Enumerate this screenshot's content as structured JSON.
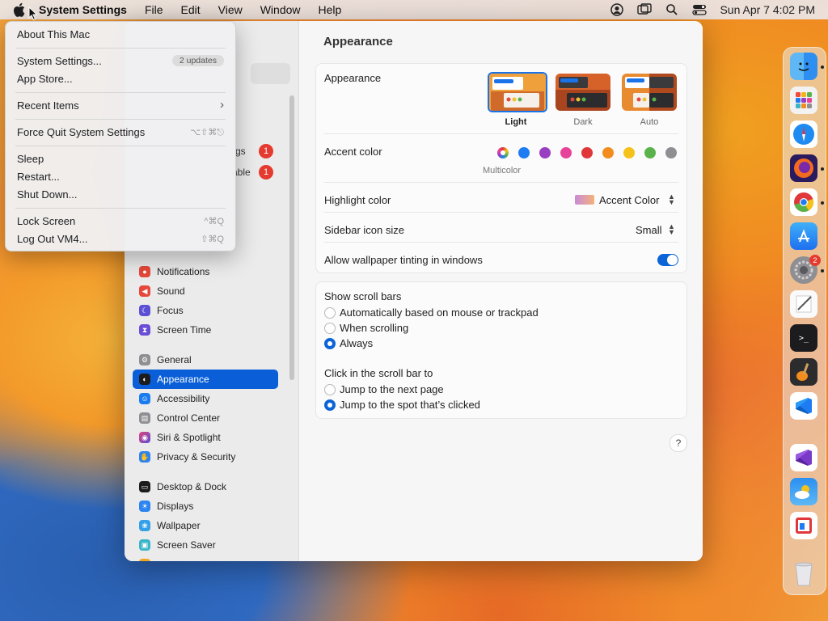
{
  "menubar": {
    "app_name": "System Settings",
    "menus": [
      "File",
      "Edit",
      "View",
      "Window",
      "Help"
    ],
    "clock": "Sun Apr 7  4:02 PM"
  },
  "apple_menu": {
    "about": "About This Mac",
    "system_settings": "System Settings...",
    "updates_badge": "2 updates",
    "app_store": "App Store...",
    "recent_items": "Recent Items",
    "force_quit": "Force Quit System Settings",
    "force_quit_shortcut": "⌥⇧⌘⎋",
    "sleep": "Sleep",
    "restart": "Restart...",
    "shut_down": "Shut Down...",
    "lock_screen": "Lock Screen",
    "lock_screen_shortcut": "^⌘Q",
    "log_out": "Log Out VM4...",
    "log_out_shortcut": "⇧⌘Q"
  },
  "sidebar": {
    "partial_1": "gs",
    "partial_2": "able",
    "badge_1": "1",
    "badge_2": "1",
    "items": [
      {
        "label": "Notifications",
        "color": "#e5483a"
      },
      {
        "label": "Sound",
        "color": "#e5483a"
      },
      {
        "label": "Focus",
        "color": "#5b4fd6"
      },
      {
        "label": "Screen Time",
        "color": "#6a4ed6"
      },
      {
        "label": "General",
        "color": "#8e8e93"
      },
      {
        "label": "Appearance",
        "color": "#1c1c1e"
      },
      {
        "label": "Accessibility",
        "color": "#1b7cf0"
      },
      {
        "label": "Control Center",
        "color": "#8e8e93"
      },
      {
        "label": "Siri & Spotlight",
        "color": "#b23ad6"
      },
      {
        "label": "Privacy & Security",
        "color": "#2b84f0"
      },
      {
        "label": "Desktop & Dock",
        "color": "#1c1c1e"
      },
      {
        "label": "Displays",
        "color": "#2b84f0"
      },
      {
        "label": "Wallpaper",
        "color": "#34a0e8"
      },
      {
        "label": "Screen Saver",
        "color": "#3ab5c8"
      }
    ]
  },
  "content": {
    "title": "Appearance",
    "appearance_label": "Appearance",
    "modes": [
      "Light",
      "Dark",
      "Auto"
    ],
    "accent_label": "Accent color",
    "accent_colors": [
      "#1e7cf2",
      "#9b3fc2",
      "#e8439a",
      "#e0383a",
      "#f28c1e",
      "#f5c21c",
      "#5ab34a",
      "#8e8e93"
    ],
    "multicolor_label": "Multicolor",
    "highlight_label": "Highlight color",
    "highlight_value": "Accent Color",
    "sidebar_icon_label": "Sidebar icon size",
    "sidebar_icon_value": "Small",
    "tinting_label": "Allow wallpaper tinting in windows",
    "scrollbars_label": "Show scroll bars",
    "scrollbars_options": [
      "Automatically based on mouse or trackpad",
      "When scrolling",
      "Always"
    ],
    "click_label": "Click in the scroll bar to",
    "click_options": [
      "Jump to the next page",
      "Jump to the spot that’s clicked"
    ],
    "help": "?"
  },
  "dock": {
    "apps": [
      "finder-icon",
      "launchpad-icon",
      "safari-icon",
      "firefox-icon",
      "chrome-icon",
      "app-store-icon",
      "system-settings-icon",
      "textedit-icon",
      "terminal-icon",
      "garageband-icon",
      "vscode-icon",
      "visual-studio-icon",
      "weather-icon",
      "parallels-icon",
      "trash-icon"
    ],
    "settings_badge": "2"
  }
}
